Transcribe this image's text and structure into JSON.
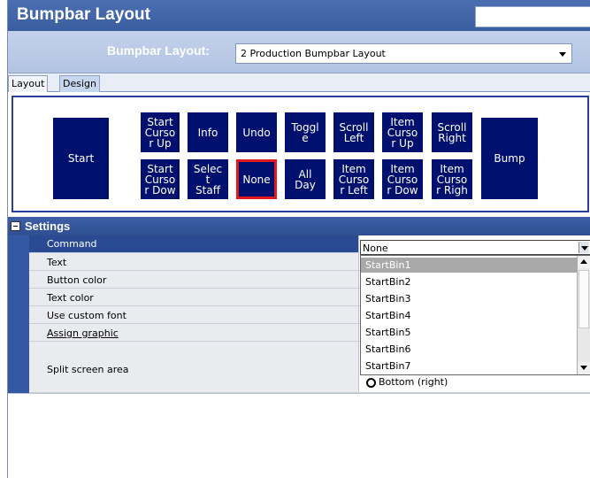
{
  "window": {
    "title": "Bumpbar Layout"
  },
  "layout_selector": {
    "label": "Bumpbar Layout:",
    "value": "2 Production Bumpbar Layout"
  },
  "tabs": [
    {
      "label": "Layout"
    },
    {
      "label": "Design"
    }
  ],
  "bumpbar": {
    "start": "Start",
    "bump": "Bump",
    "top_row": [
      "Start\nCurso\nr Up",
      "Info",
      "Undo",
      "Toggl\ne",
      "Scroll\nLeft",
      "Item\nCurso\nr Up",
      "Scroll\nRight"
    ],
    "bottom_row": [
      "Start\nCurso\nr Dow",
      "Selec\nt\nStaff",
      "None",
      "All\nDay",
      "Item\nCurso\nr Left",
      "Item\nCurso\nr Dow",
      "Item\nCurso\nr Righ"
    ],
    "selected_key": "None"
  },
  "settings": {
    "header": "Settings",
    "rows": [
      {
        "name": "Command"
      },
      {
        "name": "Text"
      },
      {
        "name": "Button color"
      },
      {
        "name": "Text color"
      },
      {
        "name": "Use custom font"
      },
      {
        "name": "Assign graphic"
      },
      {
        "name": "Split screen area"
      }
    ],
    "command_value": "None",
    "command_options": [
      "StartBin1",
      "StartBin2",
      "StartBin3",
      "StartBin4",
      "StartBin5",
      "StartBin6",
      "StartBin7"
    ],
    "highlighted_option": "StartBin1",
    "split_screen_option": "Bottom (right)"
  },
  "colors": {
    "title_bar": "#3a5d9f",
    "key_fill": "#00106e",
    "selected_key_border": "#e01a1a",
    "settings_header": "#2f4f92"
  }
}
